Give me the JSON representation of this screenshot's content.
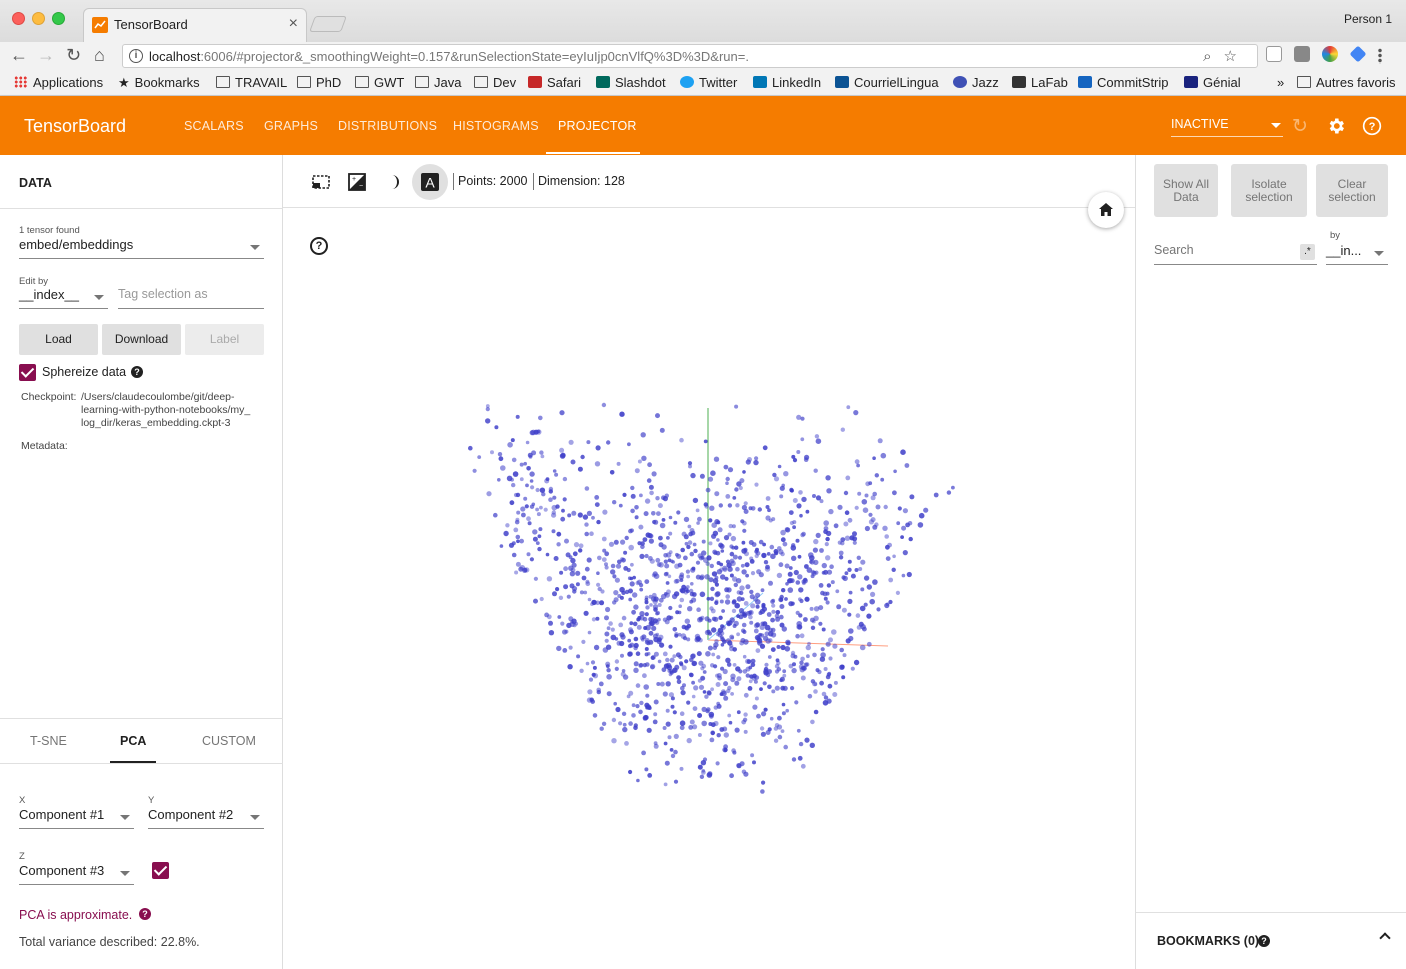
{
  "browser": {
    "tab_title": "TensorBoard",
    "profile": "Person 1",
    "url_host": "localhost",
    "url_rest": ":6006/#projector&_smoothingWeight=0.157&runSelectionState=eyIuIjp0cnVlfQ%3D%3D&run=.",
    "bookmarks": [
      "Applications",
      "Bookmarks",
      "TRAVAIL",
      "PhD",
      "GWT",
      "Java",
      "Dev",
      "Safari",
      "Slashdot",
      "Twitter",
      "LinkedIn",
      "CourrielLingua",
      "Jazz",
      "LaFab",
      "CommitStrip",
      "Génial"
    ],
    "more": "»",
    "other_bookmarks": "Autres favoris"
  },
  "header": {
    "title": "TensorBoard",
    "tabs": [
      "SCALARS",
      "GRAPHS",
      "DISTRIBUTIONS",
      "HISTOGRAMS",
      "PROJECTOR"
    ],
    "active_tab": "PROJECTOR",
    "run_status": "INACTIVE",
    "accent": "#f57c00"
  },
  "left": {
    "title": "DATA",
    "tensor_count": "1 tensor found",
    "tensor": "embed/embeddings",
    "edit_by_label": "Edit by",
    "edit_by": "__index__",
    "tag_placeholder": "Tag selection as",
    "load": "Load",
    "download": "Download",
    "label": "Label",
    "sphereize": "Sphereize data",
    "checkpoint_key": "Checkpoint:",
    "checkpoint_line1": "/Users/claudecoulombe/git/deep-",
    "checkpoint_line2": "learning-with-python-notebooks/my_",
    "checkpoint_line3": "log_dir/keras_embedding.ckpt-3",
    "metadata_key": "Metadata:",
    "proj_tabs": [
      "T-SNE",
      "PCA",
      "CUSTOM"
    ],
    "x_label": "X",
    "x_value": "Component #1",
    "y_label": "Y",
    "y_value": "Component #2",
    "z_label": "Z",
    "z_value": "Component #3",
    "pca_note": "PCA is approximate.",
    "variance": "Total variance described: 22.8%."
  },
  "center": {
    "points": "Points: 2000",
    "dimension": "Dimension: 128",
    "point_color": "#3f3fc9"
  },
  "right": {
    "show_all_1": "Show All",
    "show_all_2": "Data",
    "isolate_1": "Isolate",
    "isolate_2": "selection",
    "clear_1": "Clear",
    "clear_2": "selection",
    "search_placeholder": "Search",
    "regex": ".*",
    "by_label": "by",
    "by_value": "__in...",
    "bookmarks": "BOOKMARKS (0)"
  }
}
